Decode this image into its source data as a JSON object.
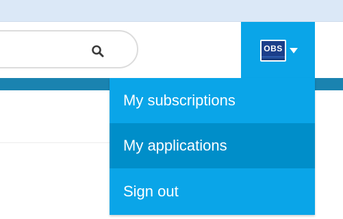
{
  "header": {
    "search": {
      "icon": "search-icon",
      "value": ""
    },
    "user": {
      "avatar_text": "OBS",
      "chevron_icon": "chevron-down-icon"
    }
  },
  "user_dropdown": {
    "items": [
      {
        "label": "My subscriptions",
        "highlighted": false
      },
      {
        "label": "My applications",
        "highlighted": true
      },
      {
        "label": "Sign out",
        "highlighted": false
      }
    ]
  },
  "colors": {
    "menu_bg": "#0aa5e8",
    "menu_hover": "#008ec9",
    "teal_bar": "#1a83b0",
    "top_strip": "#dbe8f7",
    "avatar_bg": "#1b3f8a"
  }
}
